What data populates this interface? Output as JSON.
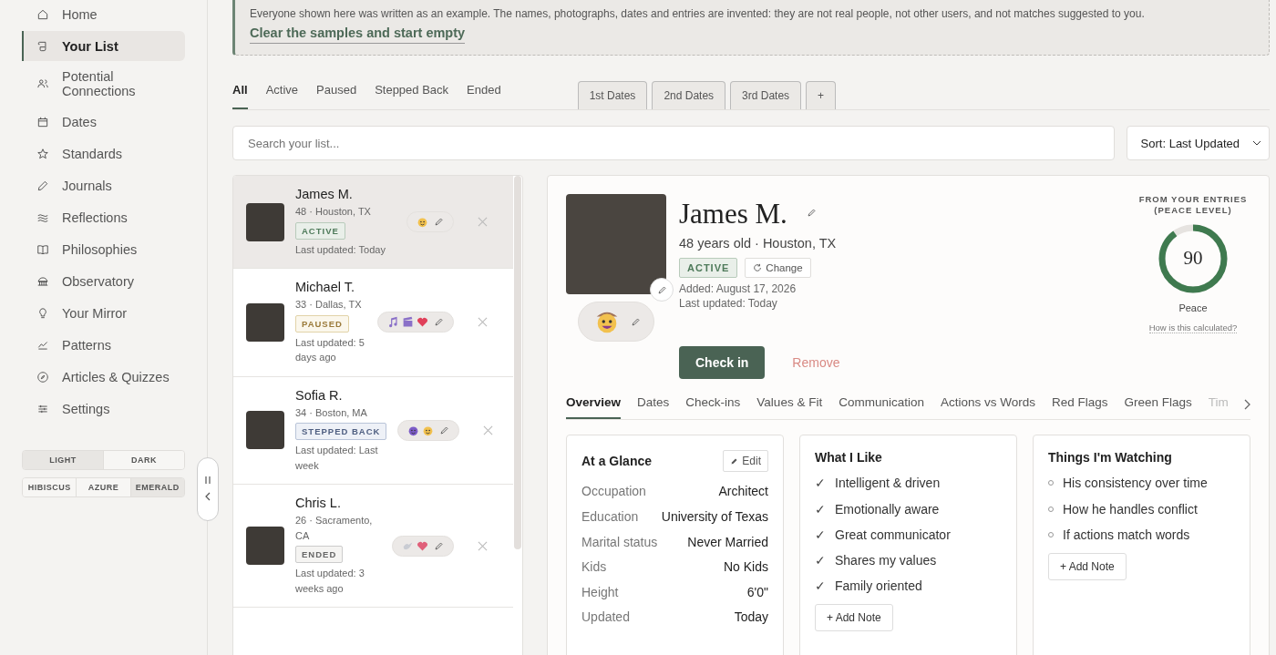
{
  "sidebar": {
    "items": [
      {
        "label": "Home",
        "selected": false
      },
      {
        "label": "Your List",
        "selected": true
      },
      {
        "label": "Potential Connections",
        "selected": false
      },
      {
        "label": "Dates",
        "selected": false
      },
      {
        "label": "Standards",
        "selected": false
      },
      {
        "label": "Journals",
        "selected": false
      },
      {
        "label": "Reflections",
        "selected": false
      },
      {
        "label": "Philosophies",
        "selected": false
      },
      {
        "label": "Observatory",
        "selected": false
      },
      {
        "label": "Your Mirror",
        "selected": false
      },
      {
        "label": "Patterns",
        "selected": false
      },
      {
        "label": "Articles & Quizzes",
        "selected": false
      },
      {
        "label": "Settings",
        "selected": false
      }
    ],
    "modes": [
      {
        "label": "LIGHT",
        "selected": true
      },
      {
        "label": "DARK",
        "selected": false
      }
    ],
    "themes": [
      {
        "label": "HIBISCUS",
        "selected": false
      },
      {
        "label": "AZURE",
        "selected": false
      },
      {
        "label": "EMERALD",
        "selected": true
      }
    ]
  },
  "notice": {
    "text": "Everyone shown here was written as an example. The names, photographs, dates and entries are invented: they are not real people, not other users, and not matches suggested to you.",
    "link": "Clear the samples and start empty"
  },
  "filter_tabs": [
    {
      "label": "All",
      "selected": true
    },
    {
      "label": "Active",
      "selected": false
    },
    {
      "label": "Paused",
      "selected": false
    },
    {
      "label": "Stepped Back",
      "selected": false
    },
    {
      "label": "Ended",
      "selected": false
    }
  ],
  "date_tabs": [
    "1st Dates",
    "2nd Dates",
    "3rd Dates",
    "+"
  ],
  "search": {
    "placeholder": "Search your list..."
  },
  "sort": {
    "value": "Sort: Last Updated"
  },
  "people": [
    {
      "name": "James M.",
      "meta": "48 · Houston, TX",
      "status": "ACTIVE",
      "kind": "active",
      "updated": "Last updated: Today",
      "moods": [
        {
          "kind": "cowboy"
        }
      ],
      "selected": true
    },
    {
      "name": "Michael T.",
      "meta": "33 · Dallas, TX",
      "status": "PAUSED",
      "kind": "paused",
      "updated": "Last updated: 5 days ago",
      "moods": [
        {
          "kind": "music"
        },
        {
          "kind": "clapper"
        },
        {
          "kind": "heart"
        }
      ],
      "selected": false
    },
    {
      "name": "Sofia R.",
      "meta": "34 · Boston, MA",
      "status": "STEPPED BACK",
      "kind": "stepped",
      "updated": "Last updated: Last week",
      "moods": [
        {
          "kind": "devil"
        },
        {
          "kind": "angel"
        }
      ],
      "selected": false
    },
    {
      "name": "Chris L.",
      "meta": "26 · Sacramento, CA",
      "status": "ENDED",
      "kind": "ended",
      "updated": "Last updated: 3 weeks ago",
      "moods": [
        {
          "kind": "dove"
        },
        {
          "kind": "broken-heart"
        }
      ],
      "selected": false
    }
  ],
  "profile": {
    "name": "James M.",
    "meta": "48 years old · Houston, TX",
    "status": "ACTIVE",
    "kind": "active",
    "change": "Change",
    "added": "Added: August 17, 2026",
    "updated": "Last updated: Today",
    "check_in": "Check in",
    "remove": "Remove",
    "peace": {
      "caption": "FROM YOUR ENTRIES (PEACE LEVEL)",
      "score": "90",
      "level": 0.9,
      "label": "Peace",
      "link": "How is this calculated?"
    },
    "tabs": [
      {
        "label": "Overview",
        "selected": true
      },
      {
        "label": "Dates",
        "selected": false
      },
      {
        "label": "Check-ins",
        "selected": false
      },
      {
        "label": "Values & Fit",
        "selected": false
      },
      {
        "label": "Communication",
        "selected": false
      },
      {
        "label": "Actions vs Words",
        "selected": false
      },
      {
        "label": "Red Flags",
        "selected": false
      },
      {
        "label": "Green Flags",
        "selected": false
      },
      {
        "label": "Tim",
        "selected": false
      }
    ],
    "glance": {
      "title": "At a Glance",
      "edit": "Edit",
      "rows": [
        {
          "label": "Occupation",
          "value": "Architect"
        },
        {
          "label": "Education",
          "value": "University of Texas"
        },
        {
          "label": "Marital status",
          "value": "Never Married"
        },
        {
          "label": "Kids",
          "value": "No Kids"
        },
        {
          "label": "Height",
          "value": "6'0\""
        },
        {
          "label": "Updated",
          "value": "Today"
        }
      ]
    },
    "likes": {
      "title": "What I Like",
      "mark": "✓",
      "items": [
        "Intelligent & driven",
        "Emotionally aware",
        "Great communicator",
        "Shares my values",
        "Family oriented"
      ],
      "add": "+ Add Note"
    },
    "watching": {
      "title": "Things I'm Watching",
      "items": [
        "His consistency over time",
        "How he handles conflict",
        "If actions match words"
      ],
      "add": "+ Add Note"
    }
  }
}
